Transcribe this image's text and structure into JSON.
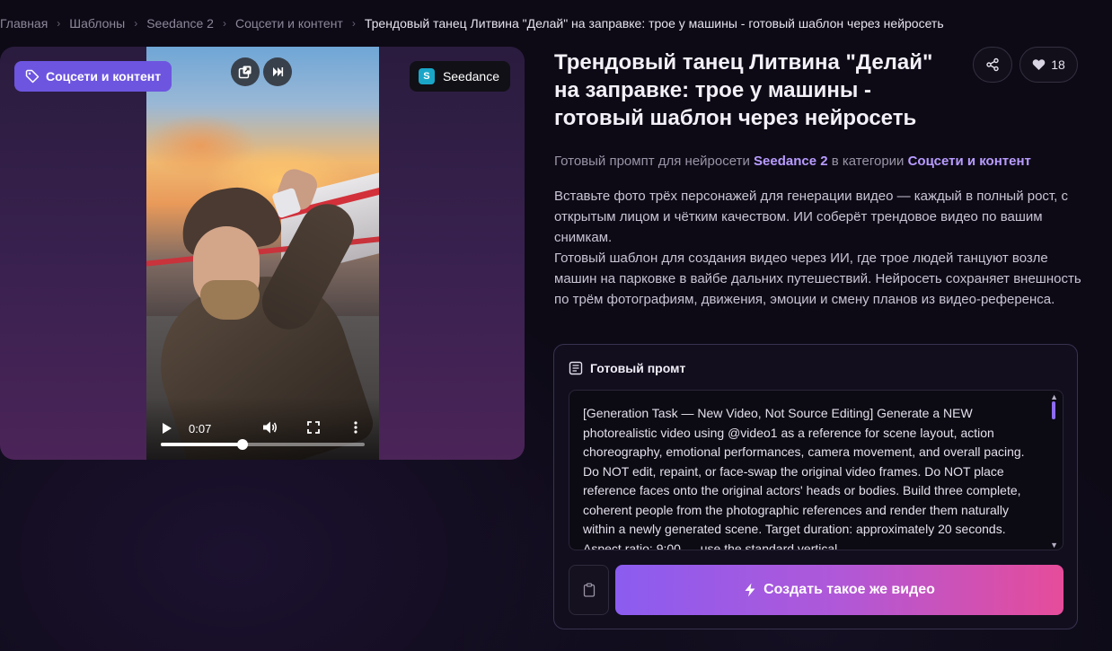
{
  "breadcrumb": {
    "items": [
      "Главная",
      "Шаблоны",
      "Seedance 2",
      "Соцсети и контент"
    ],
    "current": "Трендовый танец Литвина \"Делай\" на заправке: трое у машины - готовый шаблон через нейросеть"
  },
  "media": {
    "category_badge": "Соцсети и контент",
    "model_badge": "Seedance",
    "model_logo": "S",
    "video": {
      "time": "0:07",
      "progress": 0.4
    }
  },
  "header": {
    "title": "Трендовый танец Литвина \"Делай\" на заправке: трое у машины - готовый шаблон через нейросеть",
    "likes": "18"
  },
  "subtitle": {
    "prefix": "Готовый промпт для нейросети",
    "model": "Seedance 2",
    "middle": "в категории",
    "category": "Соцсети и контент"
  },
  "description": {
    "p1": "Вставьте фото трёх персонажей для генерации видео — каждый в полный рост, с открытым лицом и чётким качеством. ИИ соберёт трендовое видео по вашим снимкам.",
    "p2": "Готовый шаблон для создания видео через ИИ, где трое людей танцуют возле машин на парковке в вайбе дальних путешествий. Нейросеть сохраняет внешность по трём фотографиям, движения, эмоции и смену планов из видео-референса."
  },
  "prompt": {
    "heading": "Готовый промт",
    "text": "[Generation Task — New Video, Not Source Editing] Generate a NEW photorealistic video using @video1 as a reference for scene layout, action choreography, emotional performances, camera movement, and overall pacing. Do NOT edit, repaint, or face-swap the original video frames. Do NOT place reference faces onto the original actors' heads or bodies. Build three complete, coherent people from the photographic references and render them naturally within a newly generated scene. Target duration: approximately 20 seconds. Aspect ratio: 9:00 — use the standard vertical",
    "create_button": "Создать такое же видео"
  },
  "colors": {
    "accent": "#6d55e0",
    "highlight": "#b89cff",
    "button_start": "#8b5cf0",
    "button_end": "#e64c9a"
  },
  "icons": {
    "tag": "tag-icon",
    "pip": "picture-in-picture-icon",
    "skip": "skip-forward-icon",
    "play": "play-icon",
    "volume": "volume-icon",
    "fullscreen": "fullscreen-icon",
    "more": "more-vertical-icon",
    "share": "share-icon",
    "heart": "heart-icon",
    "document": "document-icon",
    "clipboard": "clipboard-icon",
    "lightning": "lightning-icon"
  }
}
